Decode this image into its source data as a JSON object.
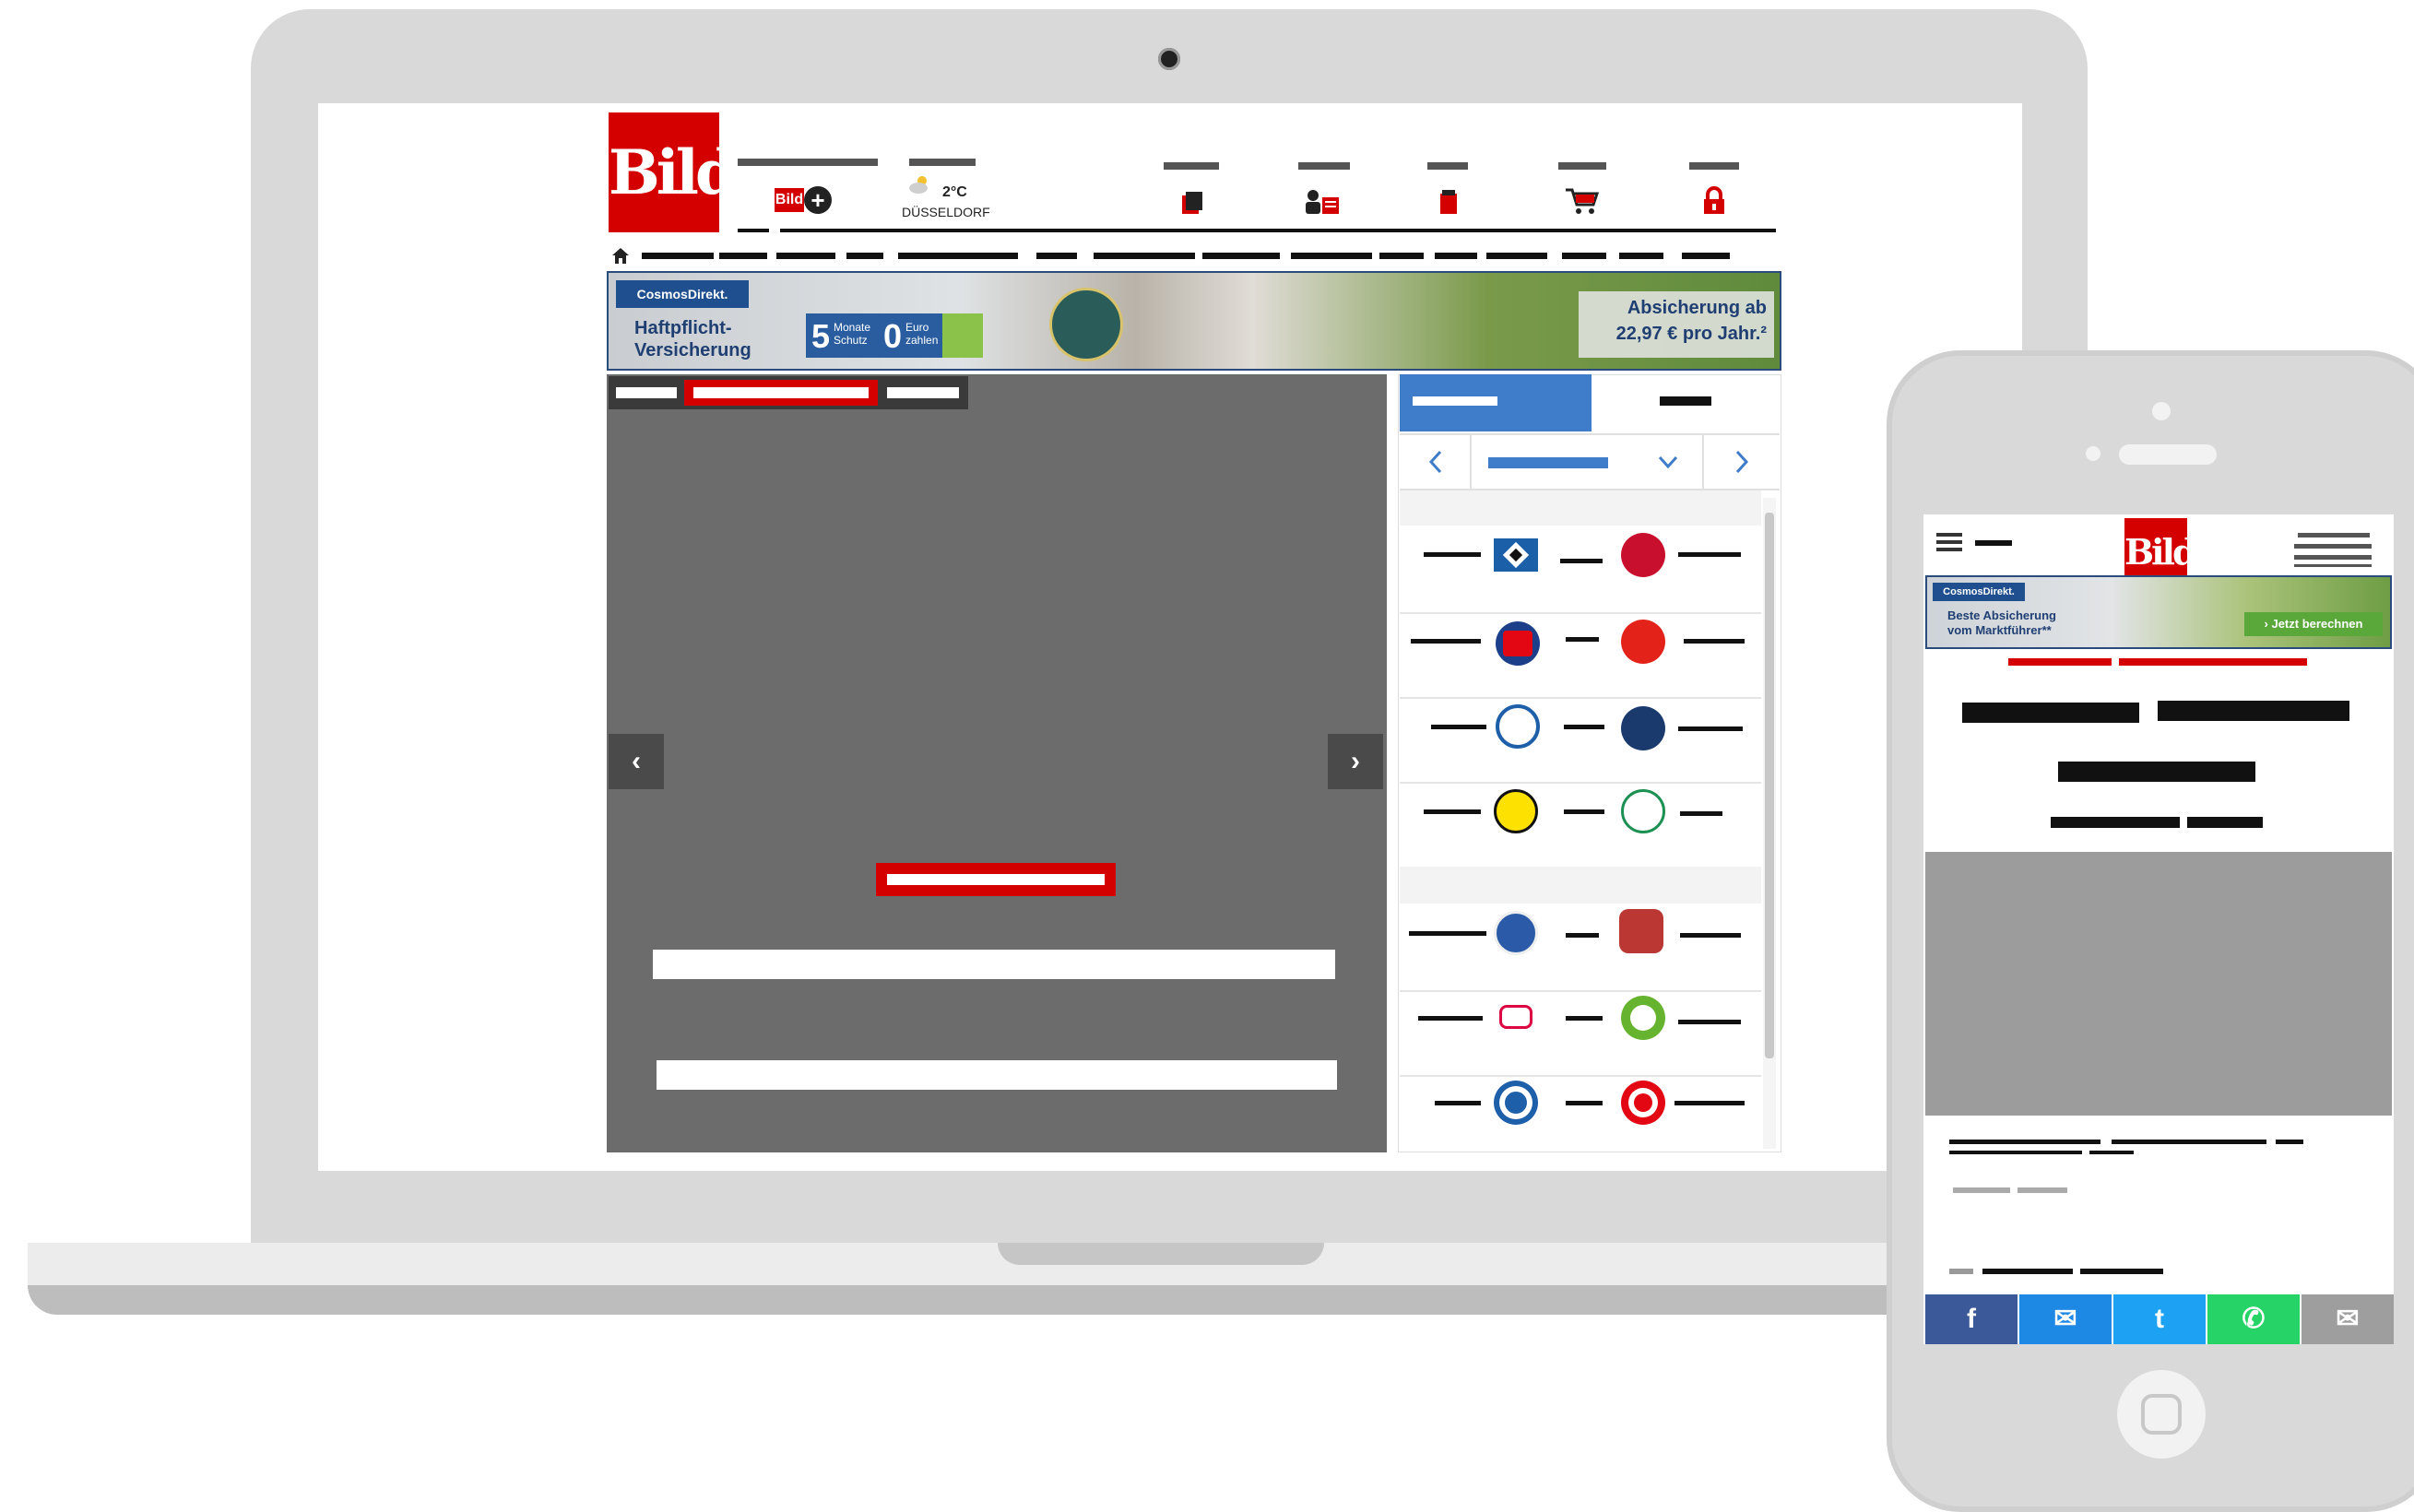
{
  "site": {
    "logo_text": "Bild",
    "bildplus_text": "Bild",
    "weather": {
      "temperature": "2°C",
      "city": "DÜSSELDORF"
    }
  },
  "desktop_banner": {
    "brand": "CosmosDirekt.",
    "product": "Haftpflicht-\nVersicherung",
    "months": "5",
    "months_label": "Monate\nSchutz",
    "euro": "0",
    "euro_label": "Euro\nzahlen",
    "claim": "Absicherung ab\n22,97 € pro Jahr.²"
  },
  "mobile_banner": {
    "brand": "CosmosDirekt.",
    "product": "Beste Absicherung\nvom Marktführer**",
    "cta": "› Jetzt berechnen"
  },
  "mobile": {
    "logo_text": "Bild"
  },
  "share": {
    "facebook": "f",
    "messenger": "✉",
    "twitter": "t",
    "whatsapp": "✆",
    "email": "✉"
  },
  "icons": {
    "home": "home-icon",
    "prev": "chevron-left-icon",
    "next": "chevron-right-icon",
    "dropdown": "chevron-down-icon",
    "menu": "hamburger-icon"
  },
  "colors": {
    "brand_red": "#d40000",
    "stage_gray": "#6c6c6c",
    "widget_tab_blue": "#3f7cc9",
    "facebook": "#3b5998",
    "messenger": "#1e88e5",
    "twitter": "#1da1f2",
    "whatsapp": "#25d366",
    "email": "#9e9e9e"
  }
}
